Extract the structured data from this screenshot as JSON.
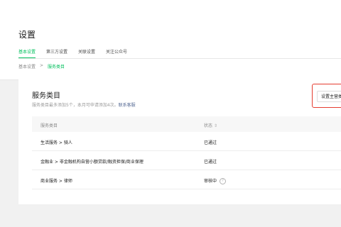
{
  "header": {
    "title": "设置",
    "tabs": [
      {
        "label": "基本设置",
        "active": true
      },
      {
        "label": "第三方设置",
        "active": false
      },
      {
        "label": "关联设置",
        "active": false
      },
      {
        "label": "关注公众号",
        "active": false
      }
    ],
    "breadcrumb": {
      "root": "基本设置",
      "separator": ">",
      "current": "服务类目"
    }
  },
  "card": {
    "title": "服务类目",
    "description": "服务类目最多添加5个，本月可申请添加4次。",
    "description_link": "联系客服",
    "action_button": "设置主营类"
  },
  "table": {
    "headers": {
      "category": "服务类目",
      "status": "状态"
    },
    "sort_icon": "⇕",
    "rows": [
      {
        "category": "生活服务 > 骑人",
        "status": "已通过",
        "help": false
      },
      {
        "category": "金融业 > 非金融机构自营小额贷款/融资担保/商业保理",
        "status": "已通过",
        "help": false
      },
      {
        "category": "商业服务 > 律师",
        "status": "审核中",
        "help": true
      }
    ],
    "help_icon": "?"
  },
  "colors": {
    "accent": "#07c160",
    "link": "#576b95",
    "highlight": "#e53d30"
  }
}
